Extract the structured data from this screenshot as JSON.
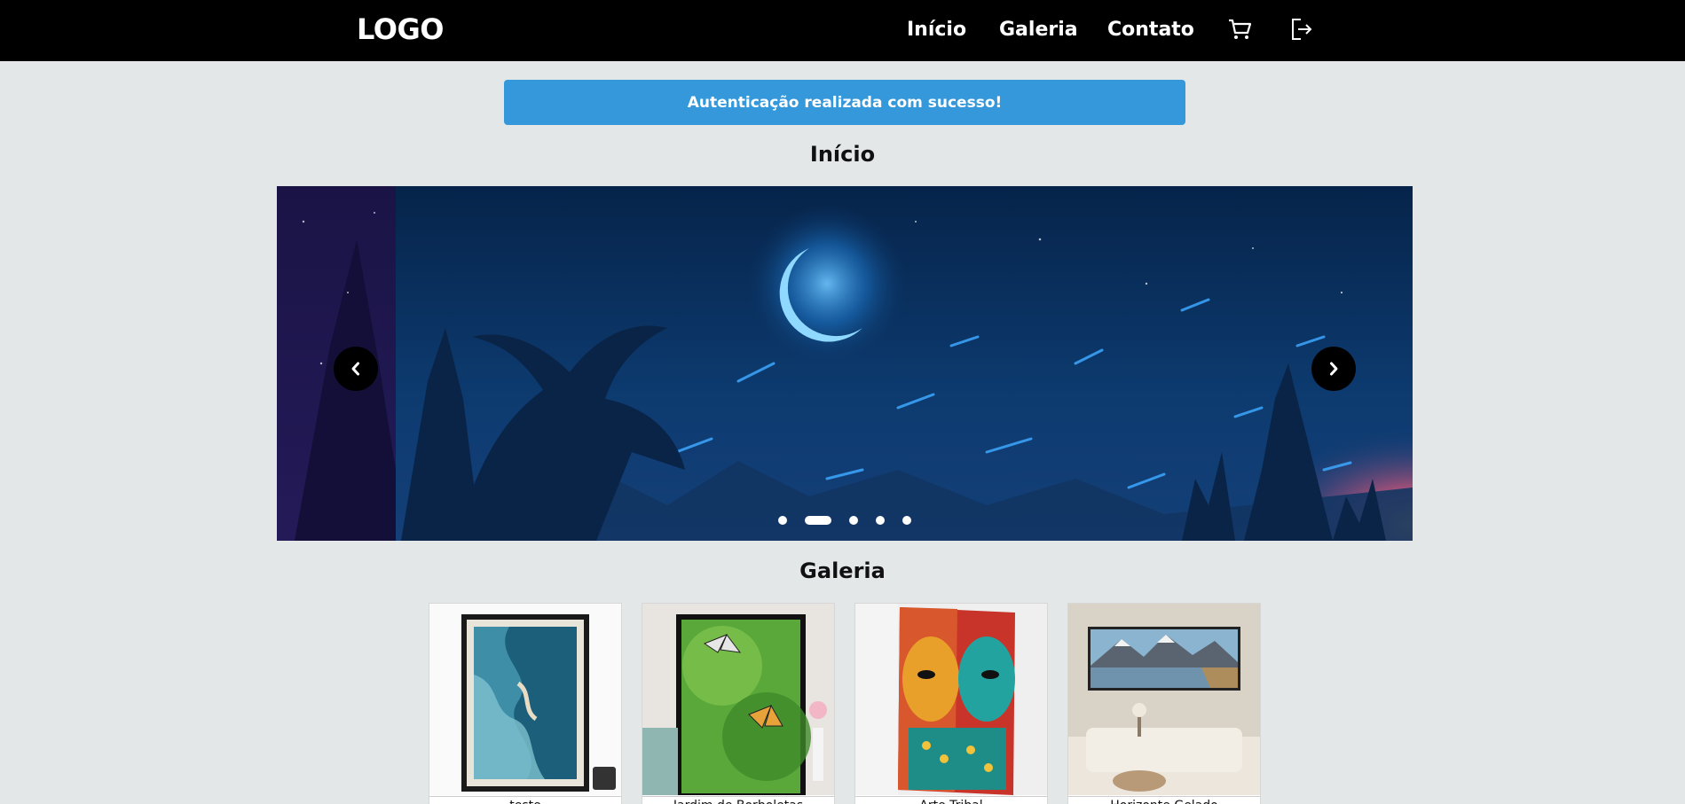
{
  "navbar": {
    "logo": "LOGO",
    "links": [
      {
        "label": "Início"
      },
      {
        "label": "Galeria"
      },
      {
        "label": "Contato"
      }
    ],
    "icons": [
      "cart-icon",
      "logout-icon"
    ]
  },
  "alert": {
    "message": "Autenticação realizada com sucesso!",
    "color": "#3498db"
  },
  "home": {
    "title": "Início"
  },
  "carousel": {
    "slide_count": 5,
    "active_index": 1,
    "prev_icon": "chevron-left-icon",
    "next_icon": "chevron-right-icon"
  },
  "gallery": {
    "title": "Galeria",
    "items": [
      {
        "caption": "teste"
      },
      {
        "caption": "Jardim de Borboletas"
      },
      {
        "caption": "Arte Tribal"
      },
      {
        "caption": "Horizonte Gelado"
      }
    ]
  }
}
